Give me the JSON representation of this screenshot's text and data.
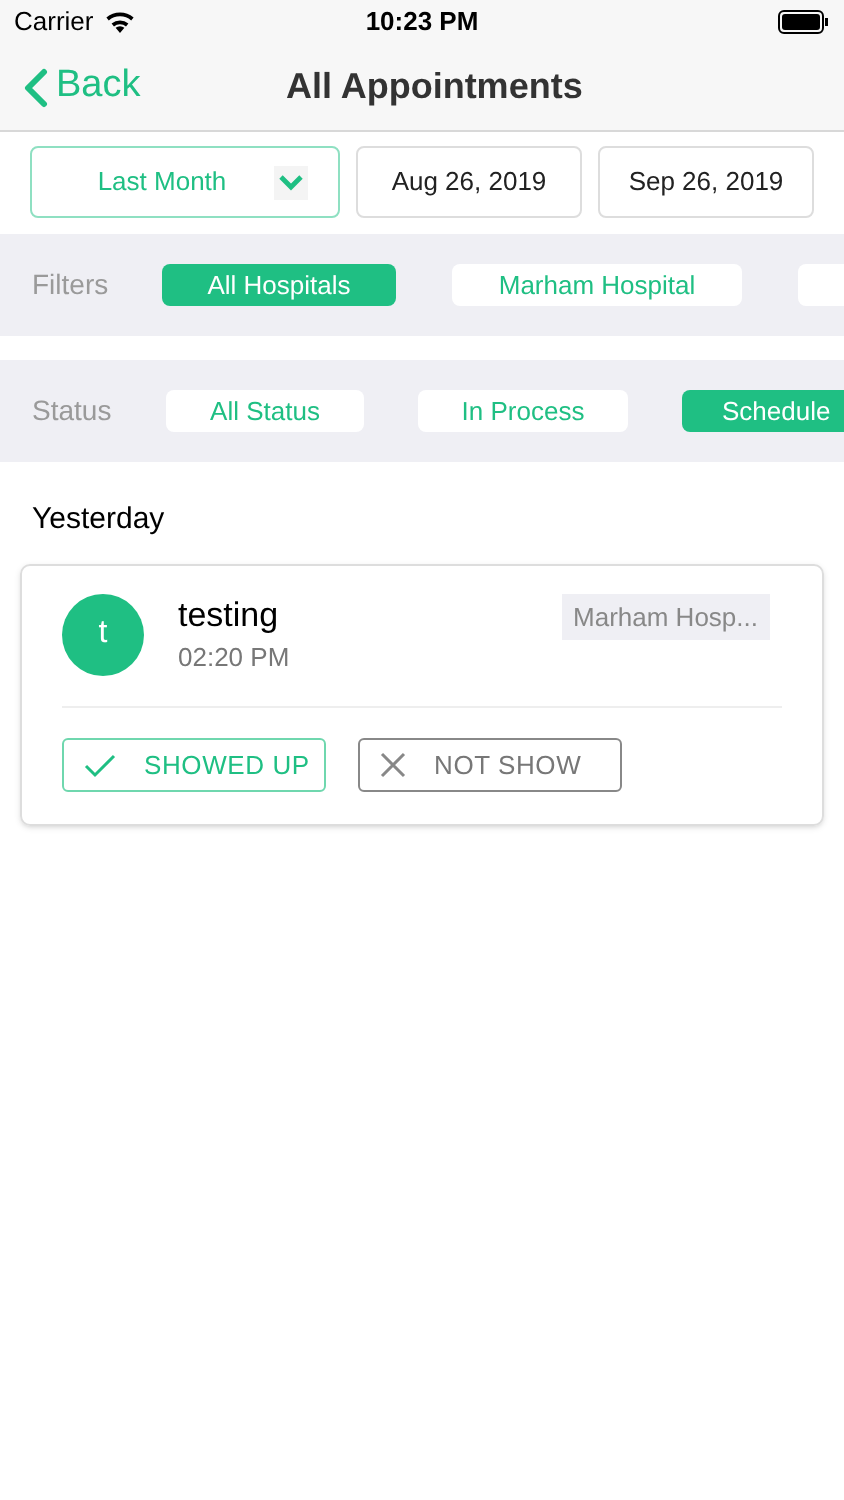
{
  "status_bar": {
    "carrier": "Carrier",
    "time": "10:23 PM"
  },
  "nav": {
    "back": "Back",
    "title": "All Appointments"
  },
  "date_range": {
    "period": "Last Month",
    "from": "Aug 26, 2019",
    "to": "Sep 26, 2019"
  },
  "filters": {
    "label": "Filters",
    "chips": [
      {
        "label": "All Hospitals",
        "selected": true
      },
      {
        "label": "Marham Hospital",
        "selected": false
      },
      {
        "selected": false
      }
    ]
  },
  "status": {
    "label": "Status",
    "chips": [
      {
        "label": "All Status",
        "selected": false
      },
      {
        "label": "In Process",
        "selected": false
      },
      {
        "label": "Schedule",
        "selected": true
      }
    ]
  },
  "sections": [
    {
      "heading": "Yesterday",
      "appointments": [
        {
          "initial": "t",
          "name": "testing",
          "time": "02:20 PM",
          "hospital": "Marham Hosp...",
          "actions": [
            {
              "kind": "confirm",
              "label": "SHOWED UP"
            },
            {
              "kind": "reject",
              "label": "NOT SHOW"
            }
          ]
        }
      ]
    }
  ]
}
